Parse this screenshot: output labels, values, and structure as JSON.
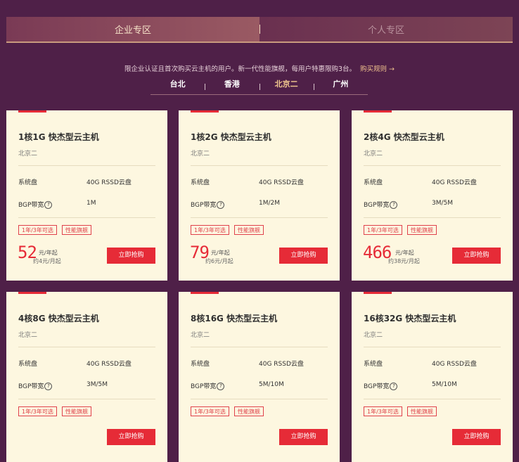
{
  "tabs": [
    {
      "label": "企业专区",
      "active": true
    },
    {
      "label": "个人专区",
      "active": false
    }
  ],
  "notice": {
    "text": "限企业认证且首次购买云主机的用户。新一代性能旗舰，每用户特惠限购3台。",
    "rule_link": "购买规则 →"
  },
  "regions": [
    {
      "label": "台北",
      "active": false
    },
    {
      "label": "香港",
      "active": false
    },
    {
      "label": "北京二",
      "active": true
    },
    {
      "label": "广州",
      "active": false
    }
  ],
  "spec_labels": {
    "disk": "系统盘",
    "bandwidth": "BGP带宽"
  },
  "tag_labels": [
    "1年/3年可选",
    "性能旗舰"
  ],
  "buy_label": "立即抢购",
  "cards": [
    {
      "title": "1核1G 快杰型云主机",
      "region": "北京二",
      "disk": "40G RSSD云盘",
      "bandwidth": "1M",
      "price": "52",
      "unit": "元/年起",
      "monthly": "约4元/月起"
    },
    {
      "title": "1核2G 快杰型云主机",
      "region": "北京二",
      "disk": "40G RSSD云盘",
      "bandwidth": "1M/2M",
      "price": "79",
      "unit": "元/年起",
      "monthly": "约6元/月起"
    },
    {
      "title": "2核4G 快杰型云主机",
      "region": "北京二",
      "disk": "40G RSSD云盘",
      "bandwidth": "3M/5M",
      "price": "466",
      "unit": "元/年起",
      "monthly": "约38元/月起"
    },
    {
      "title": "4核8G 快杰型云主机",
      "region": "北京二",
      "disk": "40G RSSD云盘",
      "bandwidth": "3M/5M",
      "price": "",
      "unit": "",
      "monthly": ""
    },
    {
      "title": "8核16G 快杰型云主机",
      "region": "北京二",
      "disk": "40G RSSD云盘",
      "bandwidth": "5M/10M",
      "price": "",
      "unit": "",
      "monthly": ""
    },
    {
      "title": "16核32G 快杰型云主机",
      "region": "北京二",
      "disk": "40G RSSD云盘",
      "bandwidth": "5M/10M",
      "price": "",
      "unit": "",
      "monthly": ""
    }
  ],
  "colors": {
    "background": "#4f2048",
    "accent_red": "#e62b37",
    "card_bg": "#fdf7e0",
    "active_gold": "#f2c98f"
  }
}
